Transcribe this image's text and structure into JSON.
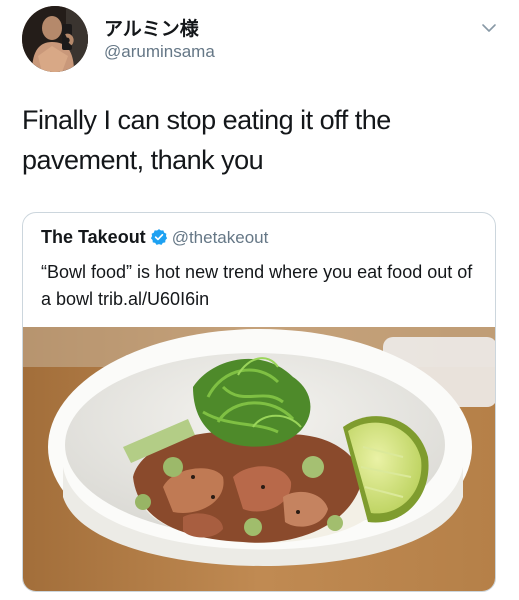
{
  "author": {
    "display_name": "アルミン様",
    "handle": "@aruminsama"
  },
  "tweet": {
    "text": "Finally I can stop eating it off the pavement, thank you"
  },
  "quoted_tweet": {
    "name": "The Takeout",
    "handle": "@thetakeout",
    "text": "“Bowl food” is hot new trend where you eat food out of a bowl trib.al/U60I6in",
    "verified": true
  },
  "colors": {
    "text": "#14171a",
    "secondary": "#657786",
    "verified": "#1da1f2",
    "border": "#ccd6dd"
  },
  "icons": {
    "menu": "chevron-down-icon",
    "verified": "verified-badge-icon"
  }
}
